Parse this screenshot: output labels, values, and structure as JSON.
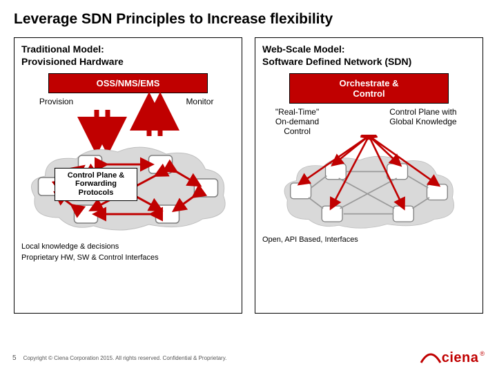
{
  "title": "Leverage SDN Principles to Increase flexibility",
  "left": {
    "title_l1": "Traditional Model:",
    "title_l2": "Provisioned Hardware",
    "hub": "OSS/NMS/EMS",
    "label_left": "Provision",
    "label_right": "Monitor",
    "overlay_l1": "Control Plane &",
    "overlay_l2": "Forwarding Protocols",
    "note1": "Local knowledge & decisions",
    "note2": "Proprietary HW, SW & Control Interfaces"
  },
  "right": {
    "title_l1": "Web-Scale Model:",
    "title_l2": "Software Defined Network (SDN)",
    "hub_l1": "Orchestrate &",
    "hub_l2": "Control",
    "label_left_l1": "\"Real-Time\"",
    "label_left_l2": "On-demand",
    "label_left_l3": "Control",
    "label_right_l1": "Control Plane with",
    "label_right_l2": "Global Knowledge",
    "note1": "Open, API Based, Interfaces"
  },
  "footer": {
    "page": "5",
    "copyright": "Copyright © Ciena Corporation 2015. All rights reserved. Confidential & Proprietary.",
    "logo_text": "ciena",
    "reg": "®"
  },
  "colors": {
    "accent": "#c00000"
  }
}
